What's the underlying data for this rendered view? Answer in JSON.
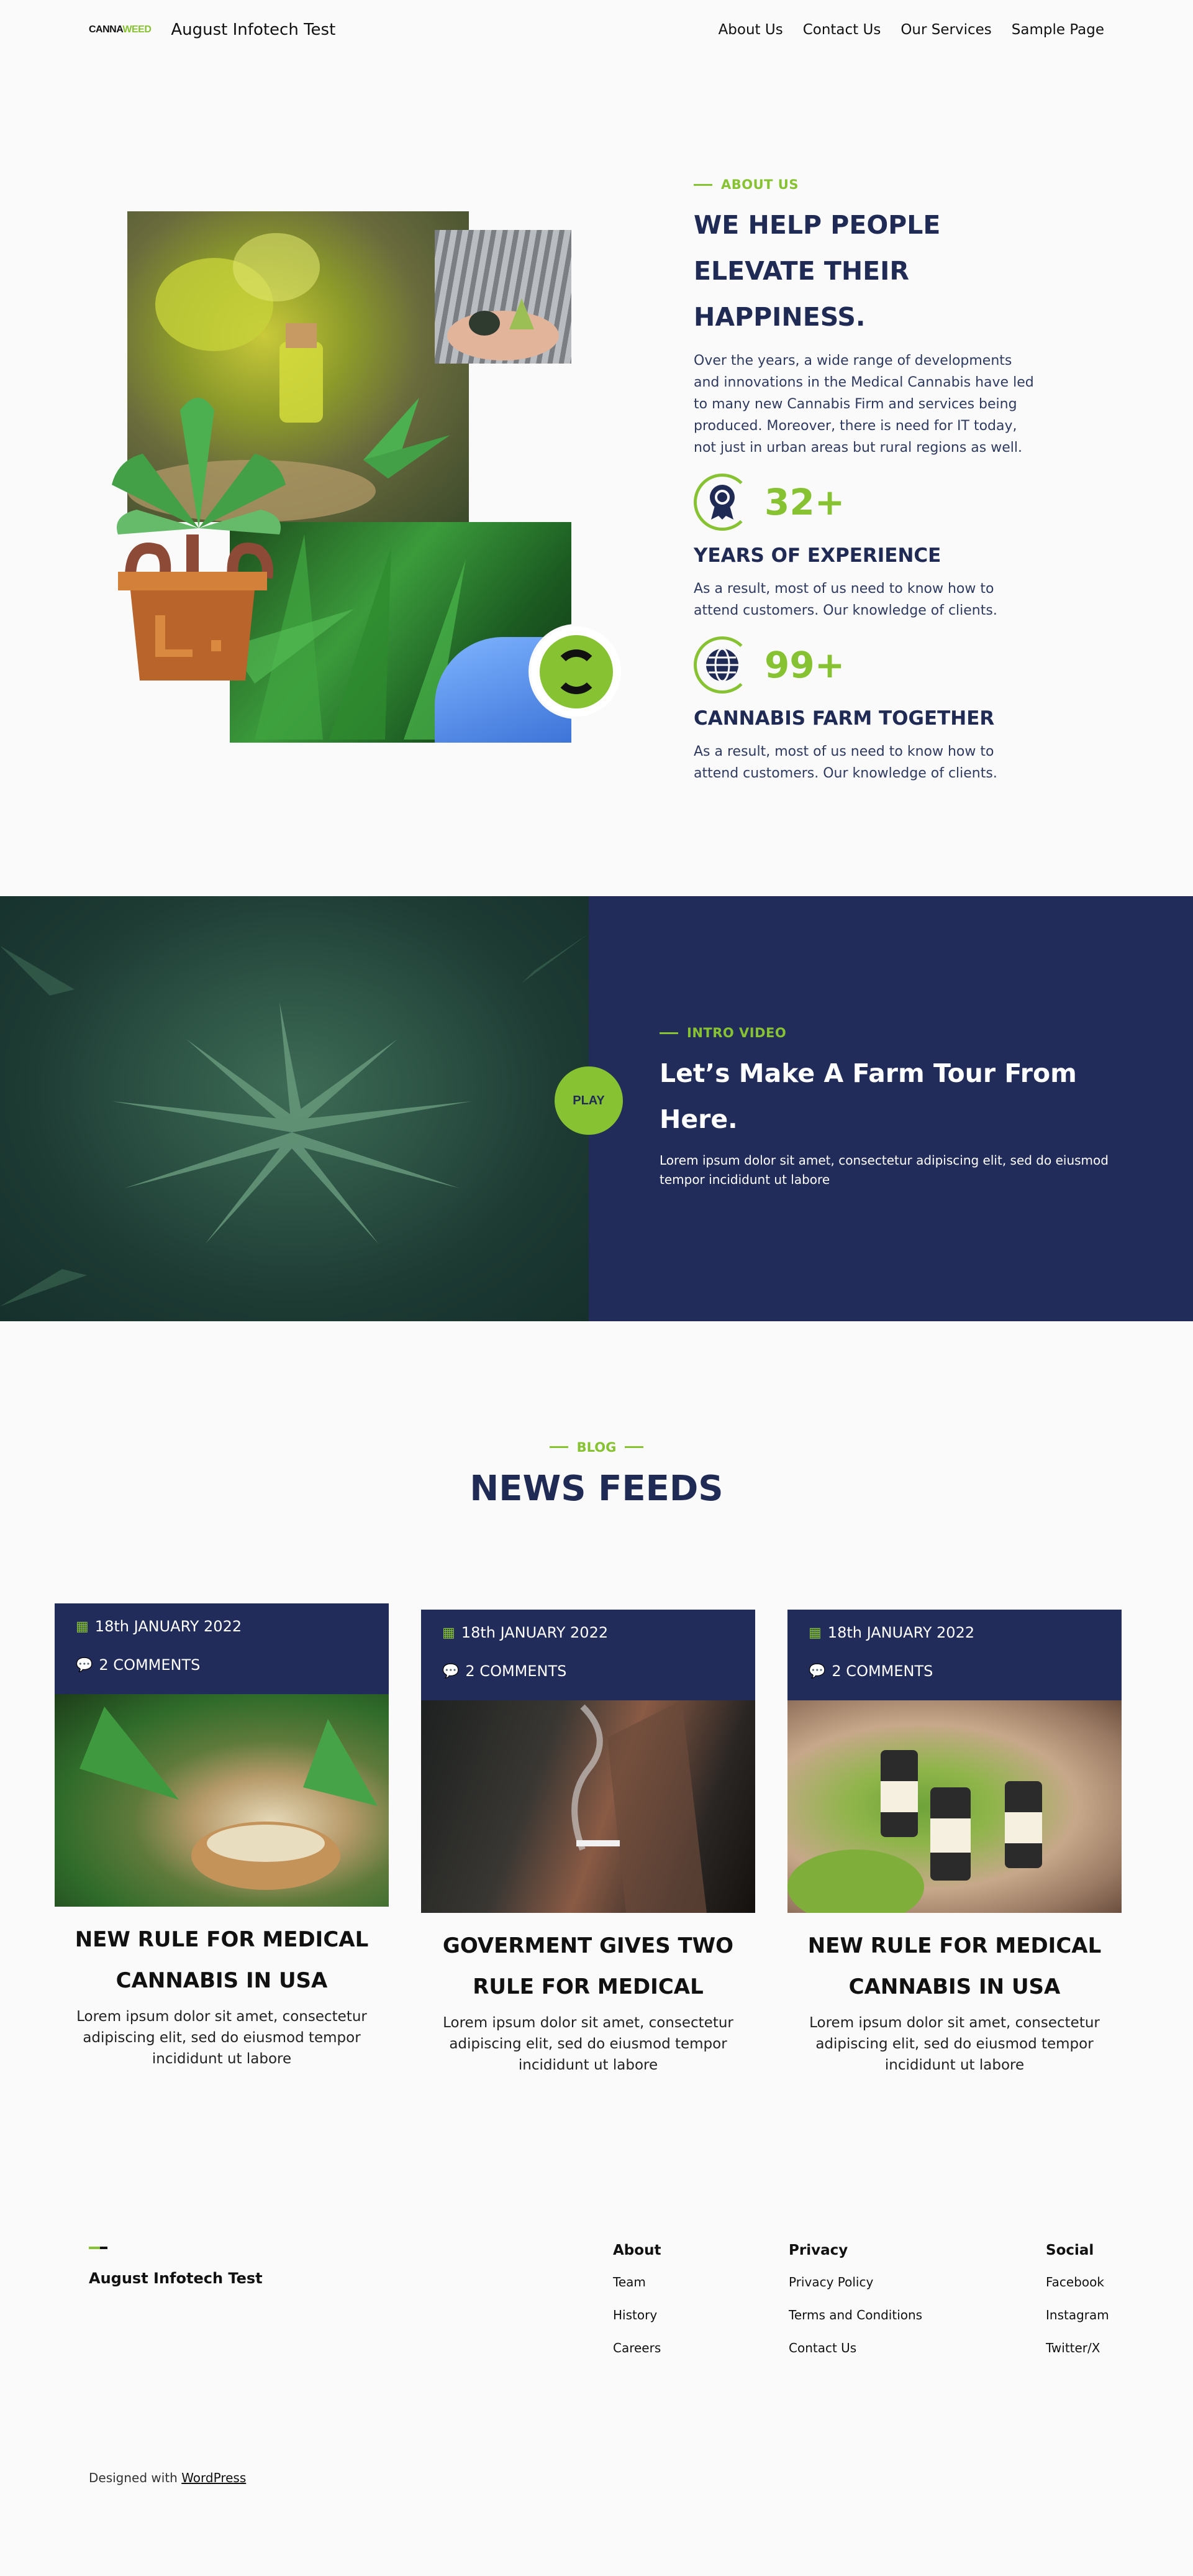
{
  "header": {
    "logo_left": "CANNA",
    "logo_right": "WEED",
    "site_title": "August Infotech Test",
    "nav": [
      "About Us",
      "Contact Us",
      "Our Services",
      "Sample Page"
    ]
  },
  "about": {
    "eyebrow": "ABOUT US",
    "title": "WE HELP PEOPLE ELEVATE THEIR HAPPINESS.",
    "description": "Over the years, a wide range of developments and innovations in the Medical Cannabis have led to many new Cannabis Firm and services being produced. Moreover, there is need for IT today, not just in urban areas but rural regions as well.",
    "stats": [
      {
        "icon": "award-icon",
        "number": "32+",
        "title": "YEARS OF EXPERIENCE",
        "description": "As a result, most of us need to know how to attend customers. Our knowledge of clients."
      },
      {
        "icon": "globe-icon",
        "number": "99+",
        "title": "CANNABIS FARM TOGETHER",
        "description": "As a result, most of us need to know how to attend customers. Our knowledge of clients."
      }
    ]
  },
  "video": {
    "eyebrow": "INTRO VIDEO",
    "play_label": "PLAY",
    "title": "Let’s Make A Farm Tour From Here.",
    "description": "Lorem ipsum dolor sit amet, consectetur adipiscing elit, sed do eiusmod tempor incididunt ut labore"
  },
  "blog": {
    "eyebrow": "BLOG",
    "title": "NEWS FEEDS",
    "cards": [
      {
        "date": "18th JANUARY 2022",
        "comments": "2 COMMENTS",
        "title": "NEW RULE FOR MEDICAL CANNABIS IN USA",
        "description": "Lorem ipsum dolor sit amet, consectetur adipiscing elit, sed do eiusmod tempor incididunt ut labore"
      },
      {
        "date": "18th JANUARY 2022",
        "comments": "2 COMMENTS",
        "title": "GOVERMENT GIVES TWO RULE FOR MEDICAL",
        "description": "Lorem ipsum dolor sit amet, consectetur adipiscing elit, sed do eiusmod tempor incididunt ut labore"
      },
      {
        "date": "18th JANUARY 2022",
        "comments": "2 COMMENTS",
        "title": "NEW RULE FOR MEDICAL CANNABIS IN USA",
        "description": "Lorem ipsum dolor sit amet, consectetur adipiscing elit, sed do eiusmod tempor incididunt ut labore"
      }
    ]
  },
  "footer": {
    "title": "August Infotech Test",
    "columns": [
      {
        "heading": "About",
        "links": [
          "Team",
          "History",
          "Careers"
        ]
      },
      {
        "heading": "Privacy",
        "links": [
          "Privacy Policy",
          "Terms and Conditions",
          "Contact Us"
        ]
      },
      {
        "heading": "Social",
        "links": [
          "Facebook",
          "Instagram",
          "Twitter/X"
        ]
      }
    ],
    "credit_prefix": "Designed with ",
    "credit_link": "WordPress"
  },
  "colors": {
    "accent": "#86c232",
    "navy": "#222c5a",
    "background": "#fafafa"
  }
}
